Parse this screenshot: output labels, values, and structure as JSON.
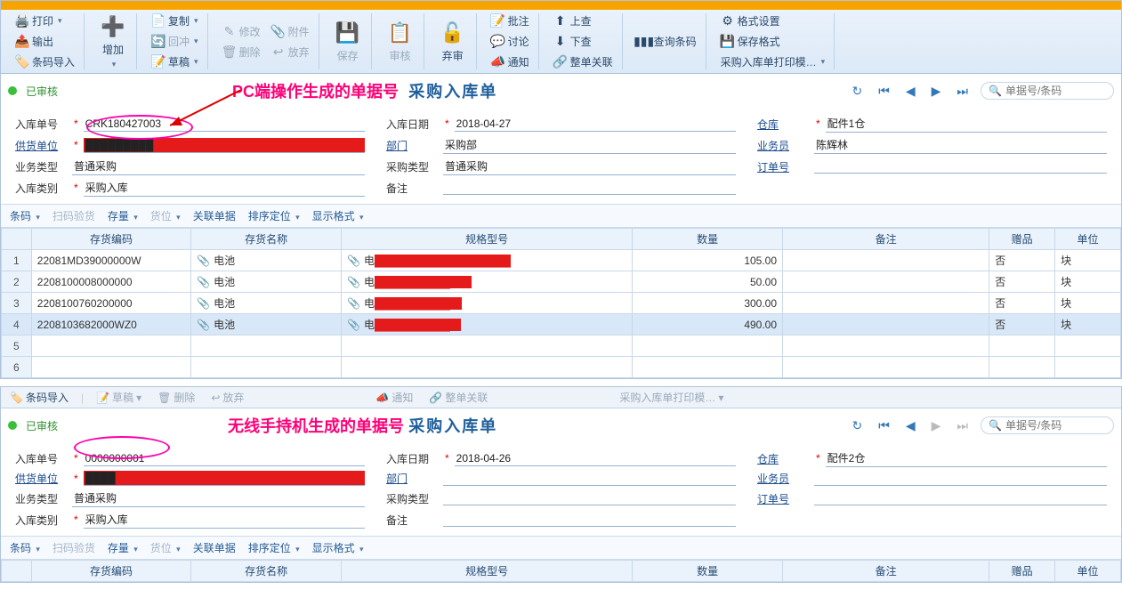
{
  "panel1": {
    "ribbon": {
      "print": "打印",
      "output": "输出",
      "barcode_import": "条码导入",
      "add": "增加",
      "copy": "复制",
      "offset": "回冲",
      "draft": "草稿",
      "modify": "修改",
      "delete": "删除",
      "attachment": "附件",
      "abandon": "放弃",
      "save": "保存",
      "audit": "审核",
      "unaudit": "弃审",
      "batch_audit": "批注",
      "discuss": "讨论",
      "notify": "通知",
      "prev_rec": "上查",
      "next_rec": "下查",
      "full_link": "整单关联",
      "query_barcode": "查询条码",
      "format_settings": "格式设置",
      "save_format": "保存格式",
      "print_template": "采购入库单打印模…"
    },
    "status": "已审核",
    "annotation": "PC端操作生成的单据号",
    "titlebar": {
      "title": "采购入库单",
      "search_placeholder": "单据号/条码"
    },
    "form": {
      "doc_no_label": "入库单号",
      "doc_no": "CRK180427003",
      "date_label": "入库日期",
      "date": "2018-04-27",
      "wh_label": "仓库",
      "wh": "配件1仓",
      "vendor_label": "供货单位",
      "vendor": "█████████",
      "dept_label": "部门",
      "dept": "采购部",
      "operator_label": "业务员",
      "operator": "陈辉林",
      "btype_label": "业务类型",
      "btype": "普通采购",
      "ptype_label": "采购类型",
      "ptype": "普通采购",
      "order_label": "订单号",
      "order": "",
      "rtype_label": "入库类别",
      "rtype": "采购入库",
      "remark_label": "备注",
      "remark": ""
    },
    "gridbar": {
      "barcode": "条码",
      "scan_recv": "扫码验货",
      "stock": "存量",
      "bin": "货位",
      "linkdoc": "关联单据",
      "sortloc": "排序定位",
      "dispfmt": "显示格式"
    },
    "columns": {
      "c1": "存货编码",
      "c2": "存货名称",
      "c3": "规格型号",
      "c4": "数量",
      "c5": "备注",
      "c6": "赠品",
      "c7": "单位"
    },
    "rows": [
      {
        "code": "22081MD39000000W",
        "name": "电池",
        "spec": "电██████████████████",
        "qty": "105.00",
        "gift": "否",
        "unit": "块"
      },
      {
        "code": "2208100008000000",
        "name": "电池",
        "spec": "电██████████W11",
        "qty": "50.00",
        "gift": "否",
        "unit": "块"
      },
      {
        "code": "2208100760200000",
        "name": "电池",
        "spec": "电██████████20",
        "qty": "300.00",
        "gift": "否",
        "unit": "块"
      },
      {
        "code": "2208103682000WZ0",
        "name": "电池",
        "spec": "电██████████字",
        "qty": "490.00",
        "gift": "否",
        "unit": "块"
      }
    ]
  },
  "panel2": {
    "ribbon": {
      "barcode_import": "条码导入",
      "draft": "草稿",
      "delete": "删除",
      "abandon": "放弃",
      "notify": "通知",
      "full_link": "整单关联",
      "print_template": "采购入库单打印模…"
    },
    "status": "已审核",
    "annotation": "无线手持机生成的单据号",
    "titlebar": {
      "title": "采购入库单",
      "search_placeholder": "单据号/条码"
    },
    "form": {
      "doc_no_label": "入库单号",
      "doc_no": "0000000001",
      "date_label": "入库日期",
      "date": "2018-04-26",
      "wh_label": "仓库",
      "wh": "配件2仓",
      "vendor_label": "供货单位",
      "vendor": "████",
      "dept_label": "部门",
      "dept": "",
      "operator_label": "业务员",
      "operator": "",
      "btype_label": "业务类型",
      "btype": "普通采购",
      "ptype_label": "采购类型",
      "ptype": "",
      "order_label": "订单号",
      "order": "",
      "rtype_label": "入库类别",
      "rtype": "采购入库",
      "remark_label": "备注",
      "remark": ""
    },
    "gridbar": {
      "barcode": "条码",
      "scan_recv": "扫码验货",
      "stock": "存量",
      "bin": "货位",
      "linkdoc": "关联单据",
      "sortloc": "排序定位",
      "dispfmt": "显示格式"
    },
    "columns": {
      "c1": "存货编码",
      "c2": "存货名称",
      "c3": "规格型号",
      "c4": "数量",
      "c5": "备注",
      "c6": "赠品",
      "c7": "单位"
    }
  }
}
